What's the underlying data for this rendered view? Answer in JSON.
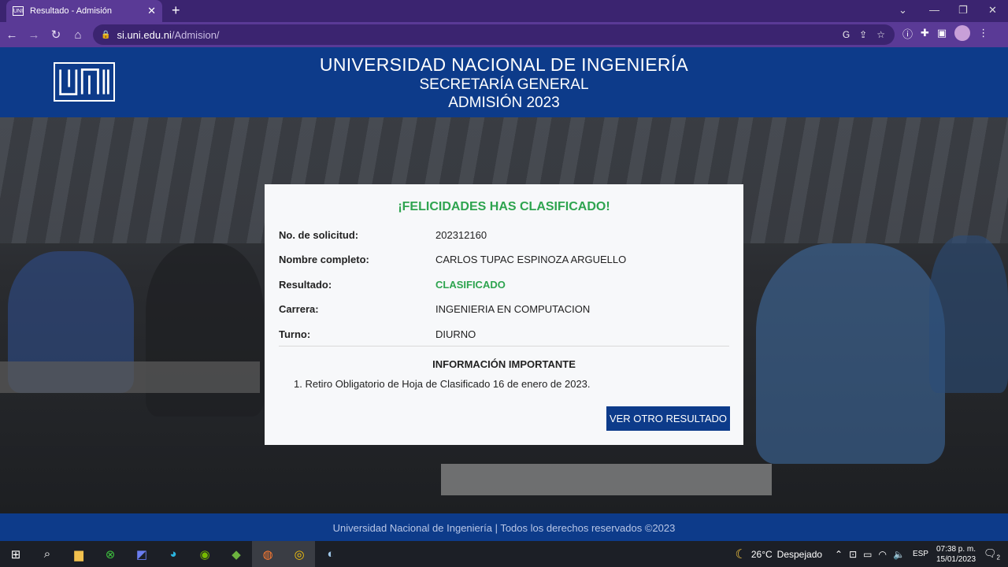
{
  "browser": {
    "tab_title": "Resultado - Admisión",
    "tab_favicon": "uni-favicon",
    "url_host": "si.uni.edu.ni",
    "url_path": "/Admision/"
  },
  "header": {
    "line1": "UNIVERSIDAD NACIONAL DE INGENIERÍA",
    "line2": "SECRETARÍA GENERAL",
    "line3": "ADMISIÓN 2023"
  },
  "card": {
    "title": "¡FELICIDADES HAS CLASIFICADO!",
    "rows": [
      {
        "label": "No. de solicitud:",
        "value": "202312160"
      },
      {
        "label": "Nombre completo:",
        "value": "CARLOS TUPAC ESPINOZA ARGUELLO"
      },
      {
        "label": "Resultado:",
        "value": "CLASIFICADO"
      },
      {
        "label": "Carrera:",
        "value": "INGENIERIA EN COMPUTACION"
      },
      {
        "label": "Turno:",
        "value": "DIURNO"
      }
    ],
    "info_title": "INFORMACIÓN IMPORTANTE",
    "info_items": [
      "1. Retiro Obligatorio de Hoja de Clasificado 16 de enero de 2023."
    ],
    "button_label": "VER OTRO RESULTADO"
  },
  "footer": {
    "text": "Universidad Nacional de Ingeniería | Todos los derechos reservados ©2023"
  },
  "taskbar": {
    "weather_temp": "26°C",
    "weather_text": "Despejado",
    "lang": "ESP",
    "time": "07:38 p. m.",
    "date": "15/01/2023",
    "notification_count": "2"
  },
  "colors": {
    "brand_blue": "#0d3b8a",
    "success_green": "#2ea44f",
    "chrome_purple": "#5a3a96"
  }
}
